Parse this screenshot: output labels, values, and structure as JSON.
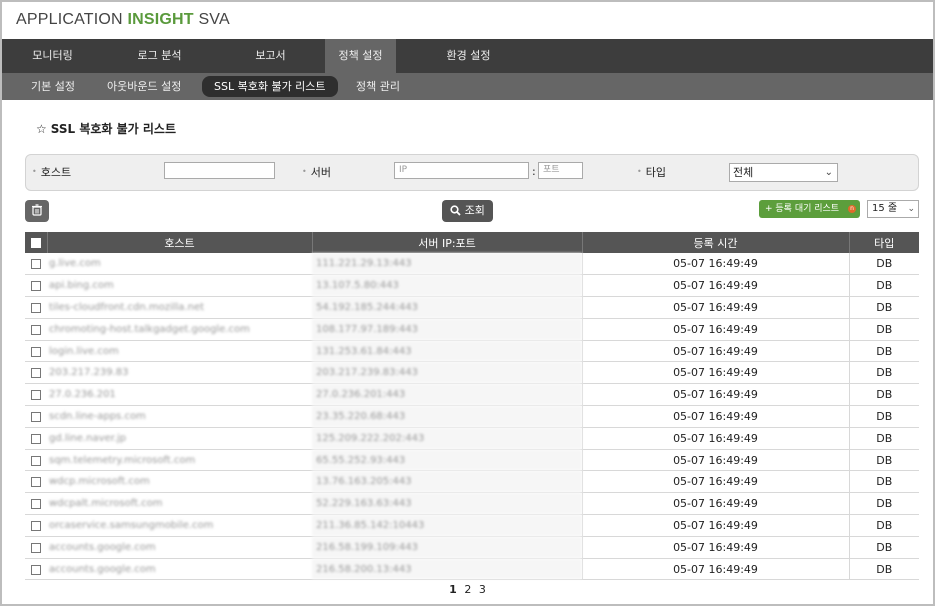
{
  "app": {
    "logo_part1": "APPLICATION",
    "logo_part2": "INSIGHT",
    "logo_part3": "SVA"
  },
  "main_nav": [
    "모니터링",
    "로그 분석",
    "보고서",
    "정책 설정",
    "환경 설정"
  ],
  "sub_nav": [
    "기본 설정",
    "아웃바운드 설정",
    "SSL 복호화 불가 리스트",
    "정책 관리"
  ],
  "page_title": "SSL 복호화 불가 리스트",
  "filter": {
    "host_label": "호스트",
    "host_value": "",
    "server_label": "서버",
    "ip_placeholder": "IP",
    "port_placeholder": "포트",
    "colon": ":",
    "type_label": "타입",
    "type_value": "전체"
  },
  "toolbar": {
    "search_label": "조회",
    "register_label": "+ 등록 대기 리스트",
    "register_badge": "n",
    "count_value": "15 줄"
  },
  "table": {
    "headers": [
      "호스트",
      "서버 IP:포트",
      "등록 시간",
      "타입"
    ],
    "rows": [
      [
        "g.live.com",
        "111.221.29.13:443",
        "05-07 16:49:49",
        "DB"
      ],
      [
        "api.bing.com",
        "13.107.5.80:443",
        "05-07 16:49:49",
        "DB"
      ],
      [
        "tiles-cloudfront.cdn.mozilla.net",
        "54.192.185.244:443",
        "05-07 16:49:49",
        "DB"
      ],
      [
        "chromoting-host.talkgadget.google.com",
        "108.177.97.189:443",
        "05-07 16:49:49",
        "DB"
      ],
      [
        "login.live.com",
        "131.253.61.84:443",
        "05-07 16:49:49",
        "DB"
      ],
      [
        "203.217.239.83",
        "203.217.239.83:443",
        "05-07 16:49:49",
        "DB"
      ],
      [
        "27.0.236.201",
        "27.0.236.201:443",
        "05-07 16:49:49",
        "DB"
      ],
      [
        "scdn.line-apps.com",
        "23.35.220.68:443",
        "05-07 16:49:49",
        "DB"
      ],
      [
        "gd.line.naver.jp",
        "125.209.222.202:443",
        "05-07 16:49:49",
        "DB"
      ],
      [
        "sqm.telemetry.microsoft.com",
        "65.55.252.93:443",
        "05-07 16:49:49",
        "DB"
      ],
      [
        "wdcp.microsoft.com",
        "13.76.163.205:443",
        "05-07 16:49:49",
        "DB"
      ],
      [
        "wdcpalt.microsoft.com",
        "52.229.163.63:443",
        "05-07 16:49:49",
        "DB"
      ],
      [
        "orcaservice.samsungmobile.com",
        "211.36.85.142:10443",
        "05-07 16:49:49",
        "DB"
      ],
      [
        "accounts.google.com",
        "216.58.199.109:443",
        "05-07 16:49:49",
        "DB"
      ],
      [
        "accounts.google.com",
        "216.58.200.13:443",
        "05-07 16:49:49",
        "DB"
      ]
    ]
  },
  "pager": {
    "pages": [
      "1",
      "2",
      "3"
    ]
  }
}
